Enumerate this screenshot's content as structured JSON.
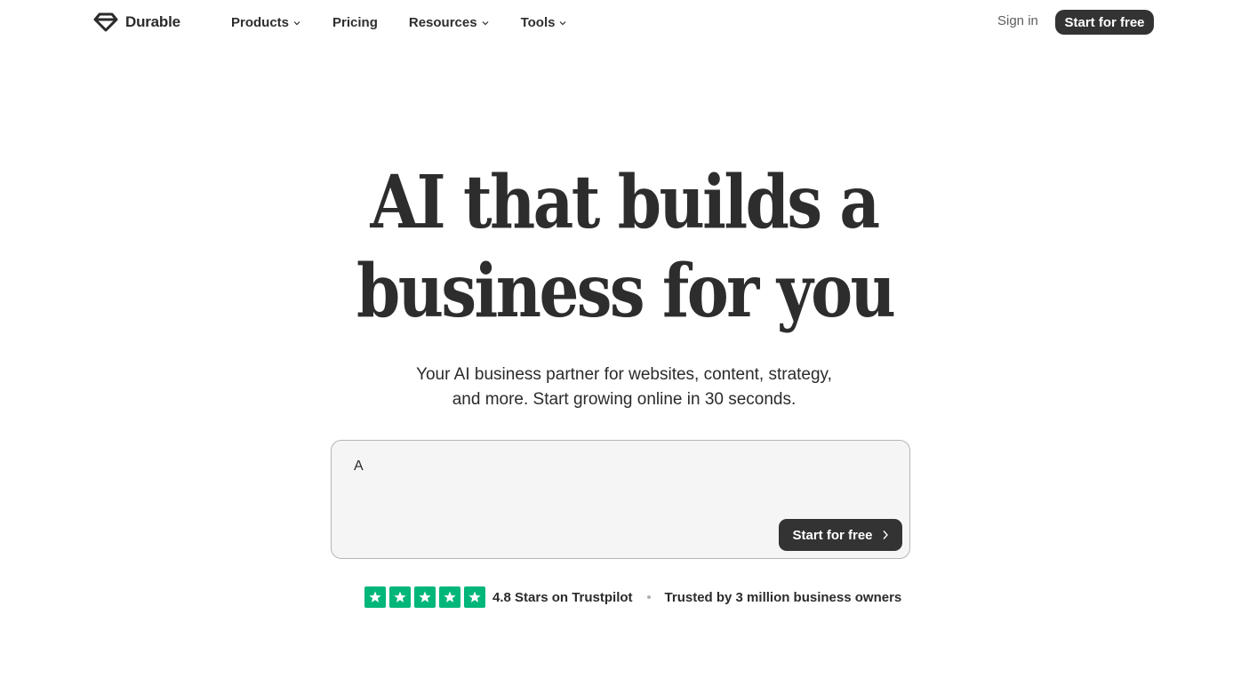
{
  "header": {
    "logo_text": "Durable",
    "nav": [
      {
        "label": "Products",
        "has_dropdown": true
      },
      {
        "label": "Pricing",
        "has_dropdown": false
      },
      {
        "label": "Resources",
        "has_dropdown": true
      },
      {
        "label": "Tools",
        "has_dropdown": true
      }
    ],
    "sign_in": "Sign in",
    "cta": "Start for free"
  },
  "hero": {
    "title_line1": "AI that builds a",
    "title_line2": "business for you",
    "subtitle_line1": "Your AI business partner for websites, content, strategy,",
    "subtitle_line2": "and more. Start growing online in 30 seconds."
  },
  "prompt": {
    "value": "A",
    "cta": "Start for free"
  },
  "trust": {
    "stars": 5,
    "rating_text": "4.8 Stars on Trustpilot",
    "trusted_text": "Trusted by 3 million business owners"
  },
  "colors": {
    "dark": "#333333",
    "trustpilot_green": "#00b67a",
    "prompt_bg": "#f5f5f5"
  }
}
